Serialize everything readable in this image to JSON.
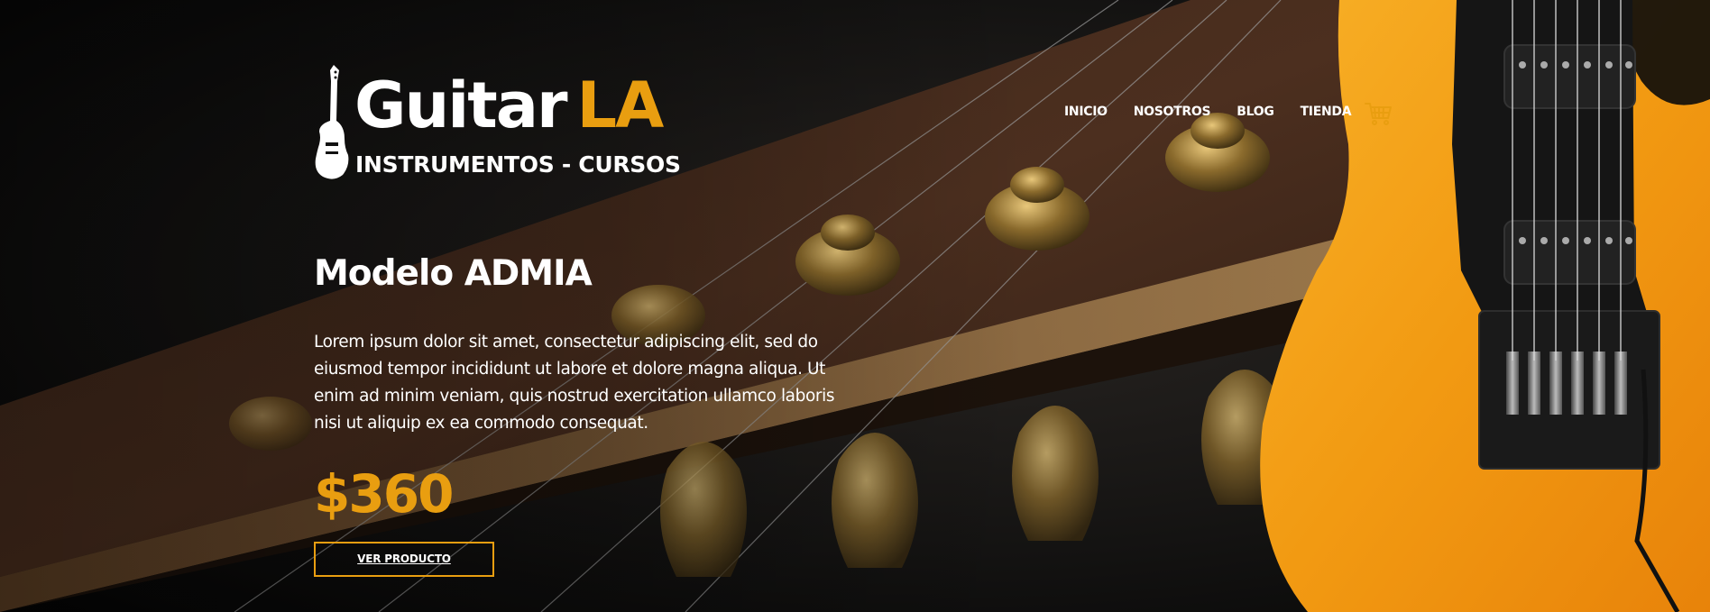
{
  "logo": {
    "word_primary": "Guitar",
    "word_accent": "LA",
    "tagline": "INSTRUMENTOS - CURSOS"
  },
  "nav": {
    "items": [
      {
        "label": "INICIO"
      },
      {
        "label": "NOSOTROS"
      },
      {
        "label": "BLOG"
      },
      {
        "label": "TIENDA"
      }
    ],
    "cart_icon": "cart-icon"
  },
  "product": {
    "title": "Modelo ADMIA",
    "description": "Lorem ipsum dolor sit amet, consectetur adipiscing elit, sed do eiusmod tempor incididunt ut labore et dolore magna aliqua. Ut enim ad minim veniam, quis nostrud exercitation ullamco laboris nisi ut aliquip ex ea commodo consequat.",
    "price": "$360",
    "button_label": "VER PRODUCTO"
  },
  "colors": {
    "accent": "#e99e10",
    "text": "#ffffff",
    "background": "#0b0b0b",
    "guitar_body": "#f5a015"
  }
}
